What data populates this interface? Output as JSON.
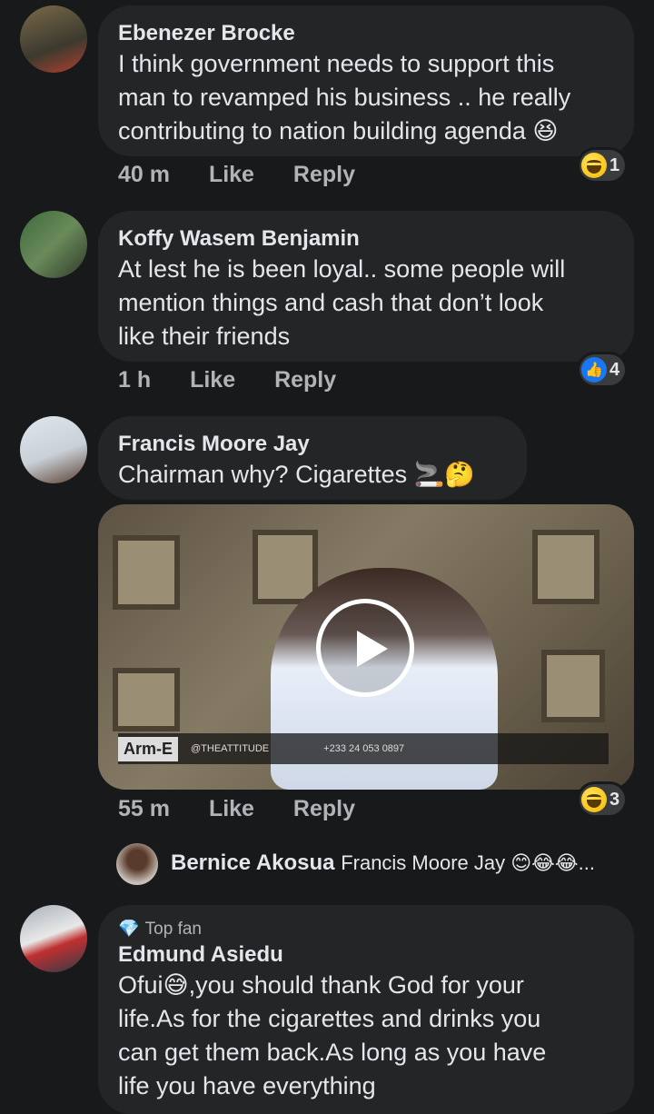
{
  "comments": [
    {
      "name": "Ebenezer Brocke",
      "lines": [
        "I think government needs to support this",
        "man to revamped his business .. he really",
        "contributing to nation building agenda 😆"
      ],
      "time": "40 m",
      "like": "Like",
      "reply": "Reply",
      "reaction_count": "1"
    },
    {
      "name": "Koffy Wasem Benjamin",
      "lines": [
        "At lest he is been loyal.. some people will",
        "mention things and cash that don’t look",
        "like their friends"
      ],
      "time": "1 h",
      "like": "Like",
      "reply": "Reply",
      "reaction_count": "4"
    },
    {
      "name": "Francis Moore Jay",
      "lines": [
        "Chairman why? Cigarettes 🚬🤔"
      ],
      "time": "55 m",
      "like": "Like",
      "reply": "Reply",
      "reaction_count": "3",
      "video_ticker": {
        "logo": "Arm-E",
        "handle": "@THEATTITUDE",
        "phone": "+233 24 053 0897"
      }
    }
  ],
  "reply_preview": {
    "name": "Bernice Akosua",
    "text": "Francis Moore Jay 😊😂😂..."
  },
  "last_comment": {
    "badge": "Top fan",
    "name": "Edmund Asiedu",
    "lines": [
      "Ofui😅,you should thank God for your",
      "life.As for the cigarettes and drinks you",
      "can get them back.As long as you have",
      "life you have everything"
    ]
  },
  "colors": {
    "background": "#18191a",
    "bubble": "#242526",
    "meta": "#b0b3b8",
    "like_blue": "#1877f2"
  }
}
